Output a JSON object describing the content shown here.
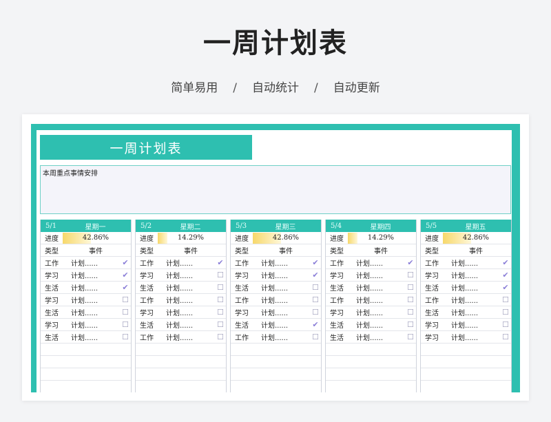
{
  "header": {
    "title": "一周计划表",
    "tags": [
      "简单易用",
      "自动统计",
      "自动更新"
    ],
    "separator": "/"
  },
  "sheet": {
    "banner": "一周计划表",
    "notes_label": "本周重点事情安排",
    "progress_label": "进度",
    "col_type": "类型",
    "col_event": "事件",
    "accent_color": "#2ebfb0",
    "days": [
      {
        "date": "5/1",
        "name": "星期一",
        "progress": "42.86%",
        "progress_value": 0.4286,
        "rows": [
          {
            "type": "工作",
            "event": "计划......",
            "done": true
          },
          {
            "type": "学习",
            "event": "计划......",
            "done": true
          },
          {
            "type": "生活",
            "event": "计划......",
            "done": true
          },
          {
            "type": "学习",
            "event": "计划......",
            "done": false
          },
          {
            "type": "生活",
            "event": "计划......",
            "done": false
          },
          {
            "type": "学习",
            "event": "计划......",
            "done": false
          },
          {
            "type": "生活",
            "event": "计划......",
            "done": false
          }
        ]
      },
      {
        "date": "5/2",
        "name": "星期二",
        "progress": "14.29%",
        "progress_value": 0.1429,
        "rows": [
          {
            "type": "工作",
            "event": "计划......",
            "done": true
          },
          {
            "type": "学习",
            "event": "计划......",
            "done": false
          },
          {
            "type": "生活",
            "event": "计划......",
            "done": false
          },
          {
            "type": "工作",
            "event": "计划......",
            "done": false
          },
          {
            "type": "学习",
            "event": "计划......",
            "done": false
          },
          {
            "type": "生活",
            "event": "计划......",
            "done": false
          },
          {
            "type": "工作",
            "event": "计划......",
            "done": false
          }
        ]
      },
      {
        "date": "5/3",
        "name": "星期三",
        "progress": "42.86%",
        "progress_value": 0.4286,
        "rows": [
          {
            "type": "工作",
            "event": "计划......",
            "done": true
          },
          {
            "type": "学习",
            "event": "计划......",
            "done": true
          },
          {
            "type": "生活",
            "event": "计划......",
            "done": false
          },
          {
            "type": "工作",
            "event": "计划......",
            "done": false
          },
          {
            "type": "学习",
            "event": "计划......",
            "done": false
          },
          {
            "type": "生活",
            "event": "计划......",
            "done": true
          },
          {
            "type": "工作",
            "event": "计划......",
            "done": false
          }
        ]
      },
      {
        "date": "5/4",
        "name": "星期四",
        "progress": "14.29%",
        "progress_value": 0.1429,
        "rows": [
          {
            "type": "工作",
            "event": "计划......",
            "done": true
          },
          {
            "type": "学习",
            "event": "计划......",
            "done": false
          },
          {
            "type": "生活",
            "event": "计划......",
            "done": false
          },
          {
            "type": "工作",
            "event": "计划......",
            "done": false
          },
          {
            "type": "学习",
            "event": "计划......",
            "done": false
          },
          {
            "type": "生活",
            "event": "计划......",
            "done": false
          },
          {
            "type": "生活",
            "event": "计划......",
            "done": false
          }
        ]
      },
      {
        "date": "5/5",
        "name": "星期五",
        "progress": "42.86%",
        "progress_value": 0.4286,
        "rows": [
          {
            "type": "工作",
            "event": "计划......",
            "done": true
          },
          {
            "type": "学习",
            "event": "计划......",
            "done": true
          },
          {
            "type": "生活",
            "event": "计划......",
            "done": true
          },
          {
            "type": "工作",
            "event": "计划......",
            "done": false
          },
          {
            "type": "生活",
            "event": "计划......",
            "done": false
          },
          {
            "type": "学习",
            "event": "计划......",
            "done": false
          },
          {
            "type": "学习",
            "event": "计划......",
            "done": false
          }
        ]
      }
    ]
  }
}
